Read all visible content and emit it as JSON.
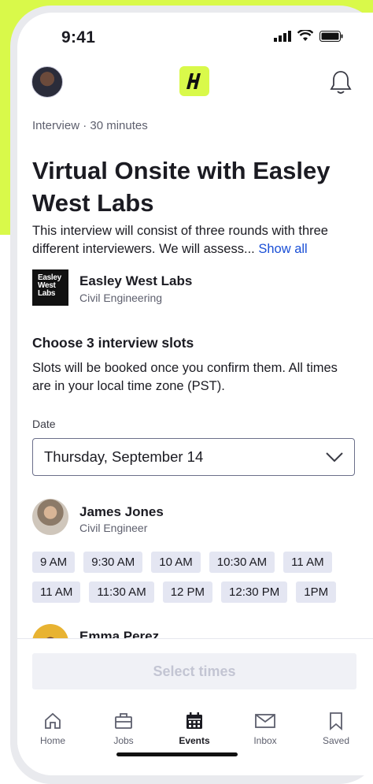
{
  "status": {
    "time": "9:41"
  },
  "interview": {
    "meta": "Interview · 30 minutes",
    "title": "Virtual Onsite with Easley West Labs",
    "description": "This interview will consist of three rounds with three different interviewers. We will assess...",
    "show_all": "Show all"
  },
  "company": {
    "logo_text": "Easley West Labs",
    "name": "Easley West Labs",
    "category": "Civil Engineering"
  },
  "slots": {
    "heading": "Choose 3 interview slots",
    "note": "Slots will be booked once you confirm them. All times are in your local time zone (PST).",
    "date_label": "Date",
    "date_value": "Thursday, September 14"
  },
  "interviewers": [
    {
      "name": "James Jones",
      "role": "Civil Engineer",
      "times_row1": [
        "9 AM",
        "9:30 AM",
        "10 AM",
        "10:30 AM",
        "11 AM"
      ],
      "times_row2": [
        "11 AM",
        "11:30 AM",
        "12 PM",
        "12:30 PM",
        "1PM"
      ]
    },
    {
      "name": "Emma Perez"
    }
  ],
  "footer": {
    "cta_label": "Select times"
  },
  "tabs": [
    {
      "label": "Home",
      "icon": "home-icon"
    },
    {
      "label": "Jobs",
      "icon": "briefcase-icon"
    },
    {
      "label": "Events",
      "icon": "calendar-icon"
    },
    {
      "label": "Inbox",
      "icon": "mail-icon"
    },
    {
      "label": "Saved",
      "icon": "bookmark-icon"
    }
  ],
  "colors": {
    "accent": "#d9f94a",
    "link": "#1a4fd6",
    "chip": "#e4e6f2"
  }
}
